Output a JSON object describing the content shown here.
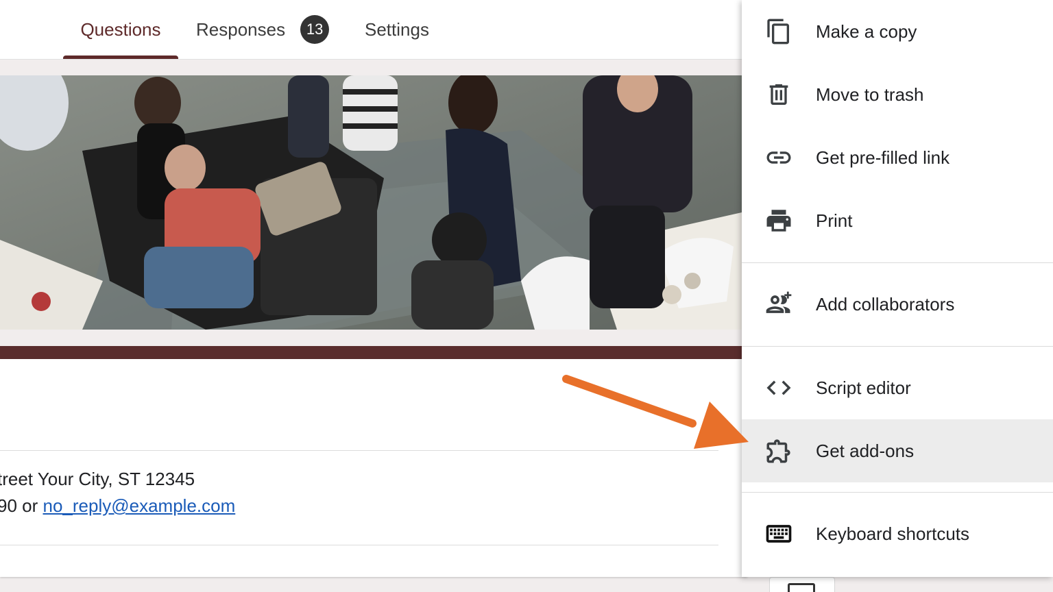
{
  "tabs": {
    "questions": "Questions",
    "responses": "Responses",
    "responses_count": "13",
    "settings": "Settings"
  },
  "form": {
    "address_line": "treet Your City, ST 12345",
    "contact_prefix": "90 or ",
    "contact_email": "no_reply@example.com"
  },
  "menu": {
    "items": [
      {
        "label": "Make a copy",
        "icon": "copy-icon"
      },
      {
        "label": "Move to trash",
        "icon": "trash-icon"
      },
      {
        "label": "Get pre-filled link",
        "icon": "link-icon"
      },
      {
        "label": "Print",
        "icon": "print-icon"
      },
      {
        "label": "Add collaborators",
        "icon": "add-people-icon"
      },
      {
        "label": "Script editor",
        "icon": "code-icon"
      },
      {
        "label": "Get add-ons",
        "icon": "puzzle-icon"
      },
      {
        "label": "Keyboard shortcuts",
        "icon": "keyboard-icon"
      }
    ],
    "highlighted_item": "Get add-ons"
  },
  "colors": {
    "theme": "#5e2a2a",
    "accent_band": "#5a2d2d",
    "arrow": "#e8702a",
    "link": "#1a5bb8",
    "highlight_bg": "#ececec"
  }
}
